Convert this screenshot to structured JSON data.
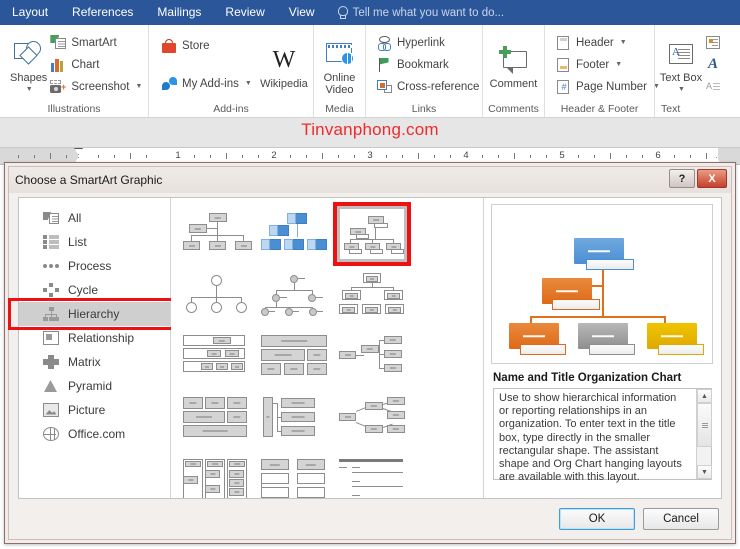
{
  "ribbon": {
    "tabs": [
      {
        "label": "Layout"
      },
      {
        "label": "References"
      },
      {
        "label": "Mailings"
      },
      {
        "label": "Review"
      },
      {
        "label": "View"
      }
    ],
    "tell_me": "Tell me what you want to do...",
    "groups": [
      {
        "label": "Illustrations",
        "big_buttons": [
          {
            "label": "Shapes",
            "icon": "shapes-icon"
          }
        ],
        "small_buttons": [
          {
            "label": "SmartArt",
            "icon": "smartart-icon"
          },
          {
            "label": "Chart",
            "icon": "chart-icon"
          },
          {
            "label": "Screenshot",
            "icon": "screenshot-icon",
            "caret": true
          }
        ]
      },
      {
        "label": "Add-ins",
        "small_buttons": [
          {
            "label": "Store",
            "icon": "store-icon"
          },
          {
            "label": "My Add-ins",
            "icon": "my-addins-icon",
            "caret": true
          }
        ],
        "big_buttons": [
          {
            "label": "Wikipedia",
            "icon": "wikipedia-icon"
          }
        ]
      },
      {
        "label": "Media",
        "big_buttons": [
          {
            "label": "Online Video",
            "icon": "online-video-icon"
          }
        ]
      },
      {
        "label": "Links",
        "small_buttons": [
          {
            "label": "Hyperlink",
            "icon": "hyperlink-icon"
          },
          {
            "label": "Bookmark",
            "icon": "bookmark-icon"
          },
          {
            "label": "Cross-reference",
            "icon": "cross-reference-icon"
          }
        ]
      },
      {
        "label": "Comments",
        "big_buttons": [
          {
            "label": "Comment",
            "icon": "comment-icon"
          }
        ]
      },
      {
        "label": "Header & Footer",
        "small_buttons": [
          {
            "label": "Header",
            "icon": "header-icon",
            "caret": true
          },
          {
            "label": "Footer",
            "icon": "footer-icon",
            "caret": true
          },
          {
            "label": "Page Number",
            "icon": "page-number-icon",
            "caret": true
          }
        ]
      },
      {
        "label": "Text",
        "big_buttons": [
          {
            "label": "Text Box",
            "icon": "text-box-icon"
          }
        ]
      }
    ]
  },
  "document": {
    "watermark": "Tinvanphong.com",
    "ruler_numbers": [
      "1",
      "2",
      "3",
      "4",
      "5",
      "6"
    ]
  },
  "dialog": {
    "title": "Choose a SmartArt Graphic",
    "help_button": "?",
    "close_button": "X",
    "categories": [
      {
        "label": "All",
        "icon": "all-icon",
        "selected": false
      },
      {
        "label": "List",
        "icon": "list-icon",
        "selected": false
      },
      {
        "label": "Process",
        "icon": "process-icon",
        "selected": false
      },
      {
        "label": "Cycle",
        "icon": "cycle-icon",
        "selected": false
      },
      {
        "label": "Hierarchy",
        "icon": "hierarchy-icon",
        "selected": true
      },
      {
        "label": "Relationship",
        "icon": "relationship-icon",
        "selected": false
      },
      {
        "label": "Matrix",
        "icon": "matrix-icon",
        "selected": false
      },
      {
        "label": "Pyramid",
        "icon": "pyramid-icon",
        "selected": false
      },
      {
        "label": "Picture",
        "icon": "picture-icon",
        "selected": false
      },
      {
        "label": "Office.com",
        "icon": "office-com-icon",
        "selected": false
      }
    ],
    "preview": {
      "title": "Name and Title Organization Chart",
      "description": "Use to show hierarchical information or reporting relationships in an organization. To enter text in the title box, type directly in the smaller rectangular shape. The assistant shape and Org Chart hanging layouts are available with this layout.",
      "colors": {
        "top": "#5b9bd5",
        "assistant": "#e1701a",
        "child1": "#e1701a",
        "child2": "#9e9e9e",
        "child3": "#e8b100"
      }
    },
    "buttons": {
      "ok": "OK",
      "cancel": "Cancel"
    },
    "highlight_color": "#ee1111"
  }
}
